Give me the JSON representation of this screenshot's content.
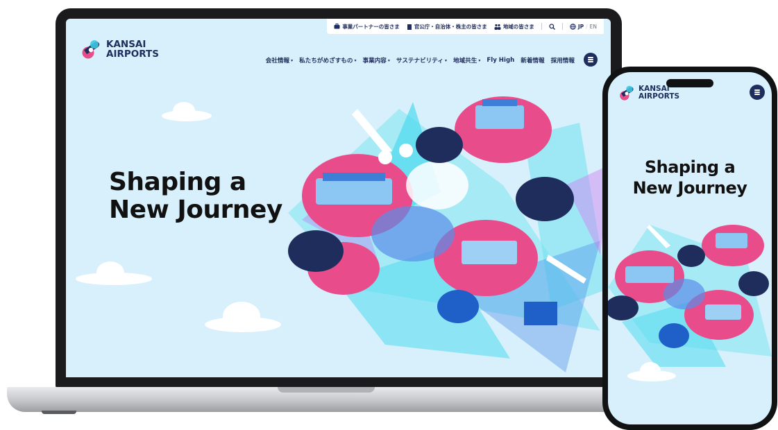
{
  "brand": {
    "line1": "KANSAI",
    "line2": "AIRPORTS",
    "colors": {
      "navy": "#1f2d5c",
      "pink": "#e84c8b",
      "sky": "#d8f0fb",
      "cyan": "#3ec6e0"
    }
  },
  "topbar": {
    "items": [
      {
        "label": "事業パートナーの皆さま",
        "icon": "briefcase-icon"
      },
      {
        "label": "官公庁・自治体・株主の皆さま",
        "icon": "building-icon"
      },
      {
        "label": "地域の皆さま",
        "icon": "people-icon"
      }
    ],
    "search_icon": "search-icon",
    "globe_icon": "globe-icon",
    "lang_jp": "JP",
    "lang_en": "EN"
  },
  "nav": {
    "items": [
      {
        "label": "会社情報",
        "dropdown": true
      },
      {
        "label": "私たちがめざすもの",
        "dropdown": true
      },
      {
        "label": "事業内容",
        "dropdown": true
      },
      {
        "label": "サステナビリティ",
        "dropdown": true
      },
      {
        "label": "地域共生",
        "dropdown": true
      },
      {
        "label": "Fly High",
        "dropdown": false
      },
      {
        "label": "新着情報",
        "dropdown": false
      },
      {
        "label": "採用情報",
        "dropdown": false
      }
    ],
    "menu_icon": "hamburger-menu-icon"
  },
  "hero": {
    "line1": "Shaping a",
    "line2": "New Journey"
  }
}
